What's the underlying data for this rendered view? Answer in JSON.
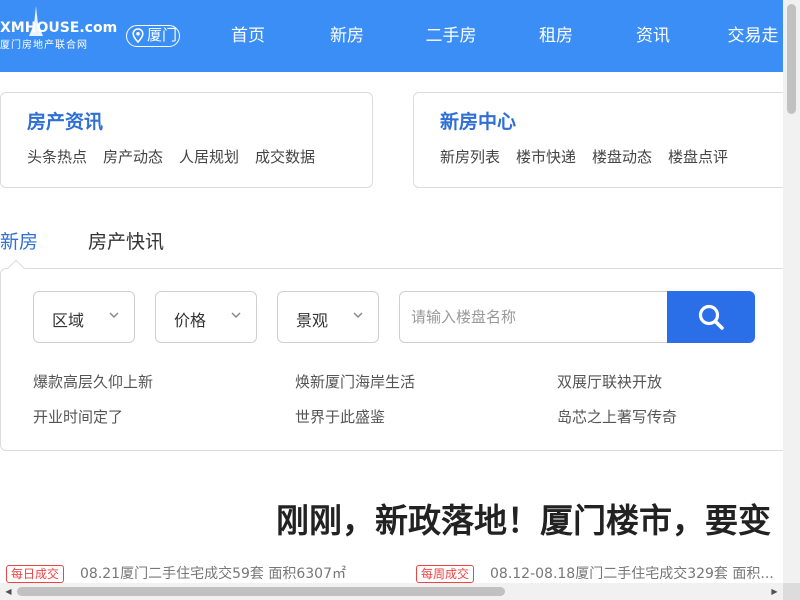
{
  "header": {
    "logo_text": "XMHOUSE.com",
    "logo_subtitle": "厦门房地产联合网",
    "city": "厦门",
    "nav": [
      "首页",
      "新房",
      "二手房",
      "租房",
      "资讯",
      "交易走"
    ]
  },
  "cards": [
    {
      "title": "房产资讯",
      "links": [
        "头条热点",
        "房产动态",
        "人居规划",
        "成交数据"
      ]
    },
    {
      "title": "新房中心",
      "links": [
        "新房列表",
        "楼市快递",
        "楼盘动态",
        "楼盘点评"
      ]
    }
  ],
  "tabs": {
    "active": "新房",
    "inactive": "房产快讯"
  },
  "search": {
    "filters": [
      "区域",
      "价格",
      "景观"
    ],
    "placeholder": "请输入楼盘名称"
  },
  "hot_links": [
    "爆款高层久仰上新",
    "焕新厦门海岸生活",
    "双展厅联袂开放",
    "开业时间定了",
    "世界于此盛鉴",
    "岛芯之上著写传奇"
  ],
  "headline": "刚刚，新政落地！厦门楼市，要变",
  "ticker": [
    {
      "tag": "每日成交",
      "text": "08.21厦门二手住宅成交59套 面积6307㎡"
    },
    {
      "tag": "每周成交",
      "text": "08.12-08.18厦门二手住宅成交329套 面积..."
    }
  ],
  "colors": {
    "header_bg": "#3b8ef5",
    "accent": "#2f6fd6",
    "search_btn": "#2a6ee8",
    "tag_red": "#ee4444"
  }
}
